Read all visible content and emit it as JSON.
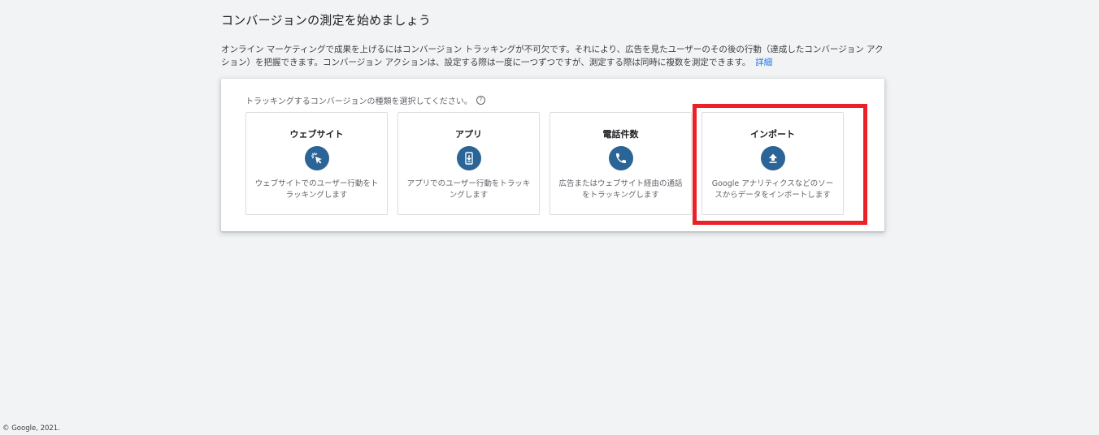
{
  "page": {
    "title": "コンバージョンの測定を始めましょう",
    "intro": "オンライン マーケティングで成果を上げるにはコンバージョン トラッキングが不可欠です。それにより、広告を見たユーザーのその後の行動（達成したコンバージョン アクション）を把握できます。コンバージョン アクションは、設定する際は一度に一つずつですが、測定する際は同時に複数を測定できます。",
    "details_link": "詳細"
  },
  "selector": {
    "prompt": "トラッキングするコンバージョンの種類を選択してください。",
    "help_icon": "?",
    "cards": [
      {
        "title": "ウェブサイト",
        "icon": "cursor-click-icon",
        "description": "ウェブサイトでのユーザー行動をトラッキングします"
      },
      {
        "title": "アプリ",
        "icon": "phone-download-icon",
        "description": "アプリでのユーザー行動をトラッキングします"
      },
      {
        "title": "電話件数",
        "icon": "phone-icon",
        "description": "広告またはウェブサイト経由の通話をトラッキングします"
      },
      {
        "title": "インポート",
        "icon": "upload-icon",
        "description": "Google アナリティクスなどのソースからデータをインポートします"
      }
    ]
  },
  "colors": {
    "icon_bg": "#2b6496",
    "highlight": "#ea2128",
    "link": "#1a73e8"
  },
  "footer": {
    "copyright": "© Google, 2021."
  }
}
